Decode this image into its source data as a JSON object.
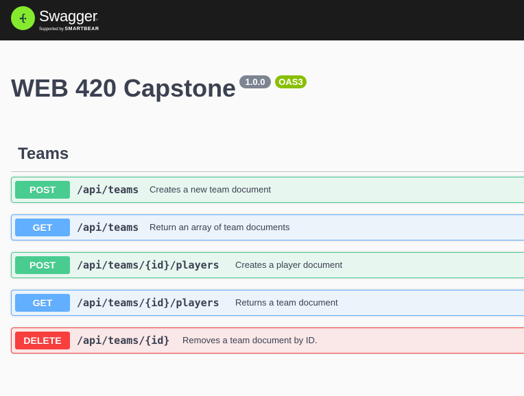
{
  "topbar": {
    "brand": "Swagger",
    "trademark": "™",
    "supported_by": "Supported by",
    "company": "SMARTBEAR",
    "colors": {
      "background": "#1b1b1b",
      "logo": "#85ea2d"
    }
  },
  "info": {
    "title": "WEB 420 Capstone",
    "version": "1.0.0",
    "oas": "OAS3",
    "colors": {
      "version_badge": "#7d8492",
      "oas_badge": "#89bf04"
    }
  },
  "tags": [
    {
      "name": "Teams",
      "operations": [
        {
          "method": "POST",
          "path": "/api/teams",
          "summary": "Creates a new team document",
          "color": "#49cc90"
        },
        {
          "method": "GET",
          "path": "/api/teams",
          "summary": "Return an array of team documents",
          "color": "#61affe"
        },
        {
          "method": "POST",
          "path": "/api/teams/{id}/players",
          "summary": "Creates a player document",
          "color": "#49cc90"
        },
        {
          "method": "GET",
          "path": "/api/teams/{id}/players",
          "summary": "Returns a team document",
          "color": "#61affe"
        },
        {
          "method": "DELETE",
          "path": "/api/teams/{id}",
          "summary": "Removes a team document by ID.",
          "color": "#f93e3e"
        }
      ]
    }
  ]
}
